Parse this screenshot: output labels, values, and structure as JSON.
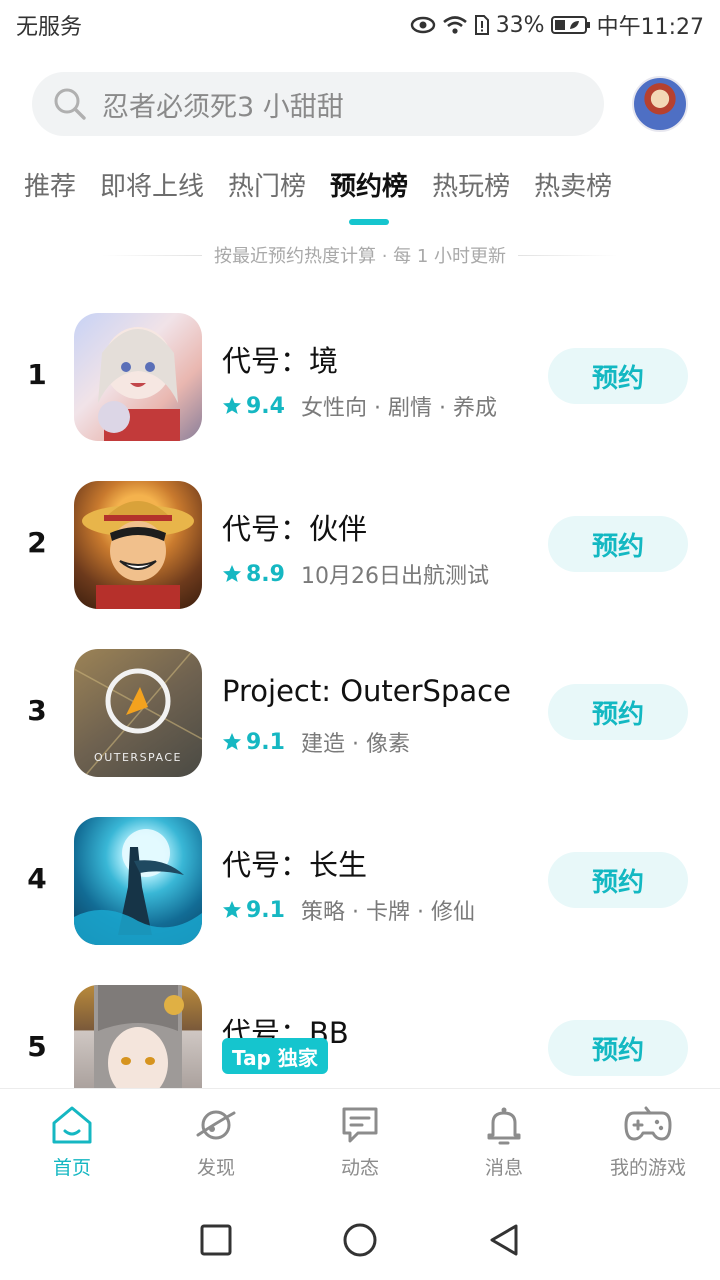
{
  "status_bar": {
    "carrier": "无服务",
    "battery": "33%",
    "time": "中午11:27"
  },
  "search": {
    "placeholder": "忍者必须死3 小甜甜"
  },
  "tabs": [
    {
      "label": "推荐",
      "active": false
    },
    {
      "label": "即将上线",
      "active": false
    },
    {
      "label": "热门榜",
      "active": false
    },
    {
      "label": "预约榜",
      "active": true
    },
    {
      "label": "热玩榜",
      "active": false
    },
    {
      "label": "热卖榜",
      "active": false
    }
  ],
  "ranking_note": "按最近预约热度计算 · 每 1 小时更新",
  "apps": [
    {
      "rank": "1",
      "name": "代号：境",
      "score": "9.4",
      "tags": "女性向 · 剧情 · 养成",
      "button": "预约"
    },
    {
      "rank": "2",
      "name": "代号：伙伴",
      "score": "8.9",
      "tags": "10月26日出航测试",
      "button": "预约"
    },
    {
      "rank": "3",
      "name": "Project: OuterSpace",
      "score": "9.1",
      "tags": "建造 · 像素",
      "button": "预约",
      "icon_text": "OUTERSPACE"
    },
    {
      "rank": "4",
      "name": "代号：长生",
      "score": "9.1",
      "tags": "策略 · 卡牌 · 修仙",
      "button": "预约"
    },
    {
      "rank": "5",
      "name": "代号：BB",
      "badge": "Tap 独家",
      "button": "预约"
    }
  ],
  "bottom_nav": [
    {
      "label": "首页",
      "icon": "home-icon",
      "active": true
    },
    {
      "label": "发现",
      "icon": "planet-icon",
      "active": false
    },
    {
      "label": "动态",
      "icon": "chat-icon",
      "active": false
    },
    {
      "label": "消息",
      "icon": "bell-icon",
      "active": false
    },
    {
      "label": "我的游戏",
      "icon": "gamepad-icon",
      "active": false
    }
  ],
  "colors": {
    "accent": "#15b7c2",
    "reserve_bg": "#e8f8f9"
  }
}
